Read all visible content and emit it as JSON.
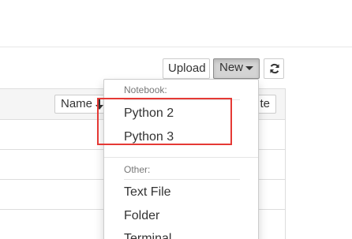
{
  "toolbar": {
    "upload_label": "Upload",
    "new_label": "New",
    "refresh_icon": "refresh-icon"
  },
  "list": {
    "name_header": "Name",
    "sort_icon": "sort-down-icon",
    "modified_header_partial": "te"
  },
  "new_menu": {
    "notebook_header": "Notebook:",
    "notebook_items": [
      "Python 2",
      "Python 3"
    ],
    "other_header": "Other:",
    "other_items": [
      "Text File",
      "Folder",
      "Terminal"
    ]
  },
  "colors": {
    "highlight": "#e53935",
    "active_button": "#d4d4d4",
    "header_bg": "#f5f5f5"
  }
}
